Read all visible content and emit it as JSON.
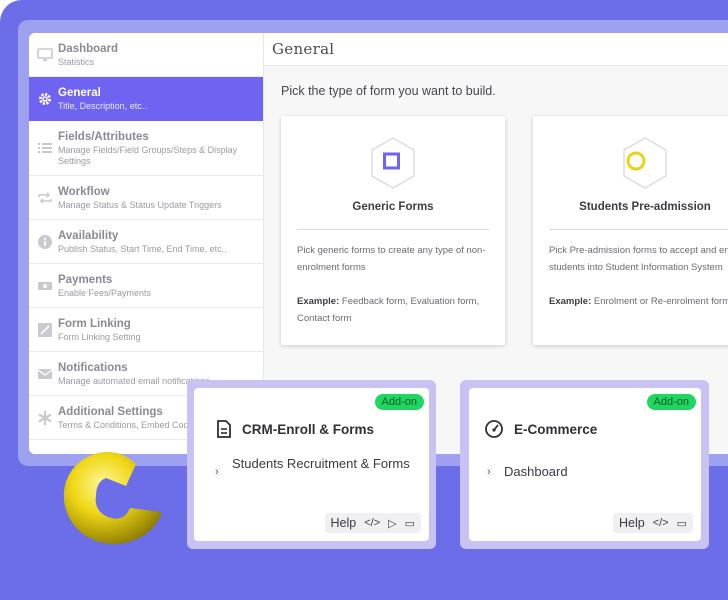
{
  "sidebar": {
    "items": [
      {
        "title": "Dashboard",
        "sub": "Statistics",
        "icon": "monitor-icon"
      },
      {
        "title": "General",
        "sub": "Title, Description, etc..",
        "icon": "gear-icon"
      },
      {
        "title": "Fields/Attributes",
        "sub": "Manage Fields/Field Groups/Steps & Display Settings",
        "icon": "list-icon"
      },
      {
        "title": "Workflow",
        "sub": "Manage Status & Status Update Triggers",
        "icon": "repeat-icon"
      },
      {
        "title": "Availability",
        "sub": "Publish Status, Start Time, End Time, etc..",
        "icon": "info-icon"
      },
      {
        "title": "Payments",
        "sub": "Enable Fees/Payments",
        "icon": "money-icon"
      },
      {
        "title": "Form Linking",
        "sub": "Form Linking Setting",
        "icon": "link-icon"
      },
      {
        "title": "Notifications",
        "sub": "Manage automated email notifications",
        "icon": "envelope-icon"
      },
      {
        "title": "Additional Settings",
        "sub": "Terms & Conditions, Embed Code",
        "icon": "asterisk-icon"
      }
    ]
  },
  "main": {
    "title": "General",
    "prompt": "Pick the type of form you want to build.",
    "cards": [
      {
        "title": "Generic Forms",
        "desc": "Pick generic forms to create any type of non-enrolment forms",
        "example_label": "Example:",
        "example": "Feedback form, Evaluation form, Contact form",
        "icon": "square-hexagon-icon"
      },
      {
        "title": "Students Pre-admission",
        "desc": "Pick Pre-admission forms to accept and enrol students into Student Information System",
        "example_label": "Example:",
        "example": "Enrolment or Re-enrolment forms",
        "icon": "circle-hexagon-icon"
      }
    ]
  },
  "addons": [
    {
      "badge": "Add-on",
      "title": "CRM-Enroll & Forms",
      "link": "Students Recruitment & Forms",
      "icon": "document-icon",
      "footer_help": "Help"
    },
    {
      "badge": "Add-on",
      "title": "E-Commerce",
      "link": "Dashboard",
      "icon": "speedometer-icon",
      "footer_help": "Help"
    }
  ],
  "colors": {
    "accent": "#6f63f2",
    "background": "#6b6ee8",
    "badge": "#1fd760",
    "logo": "#e8d31a"
  }
}
